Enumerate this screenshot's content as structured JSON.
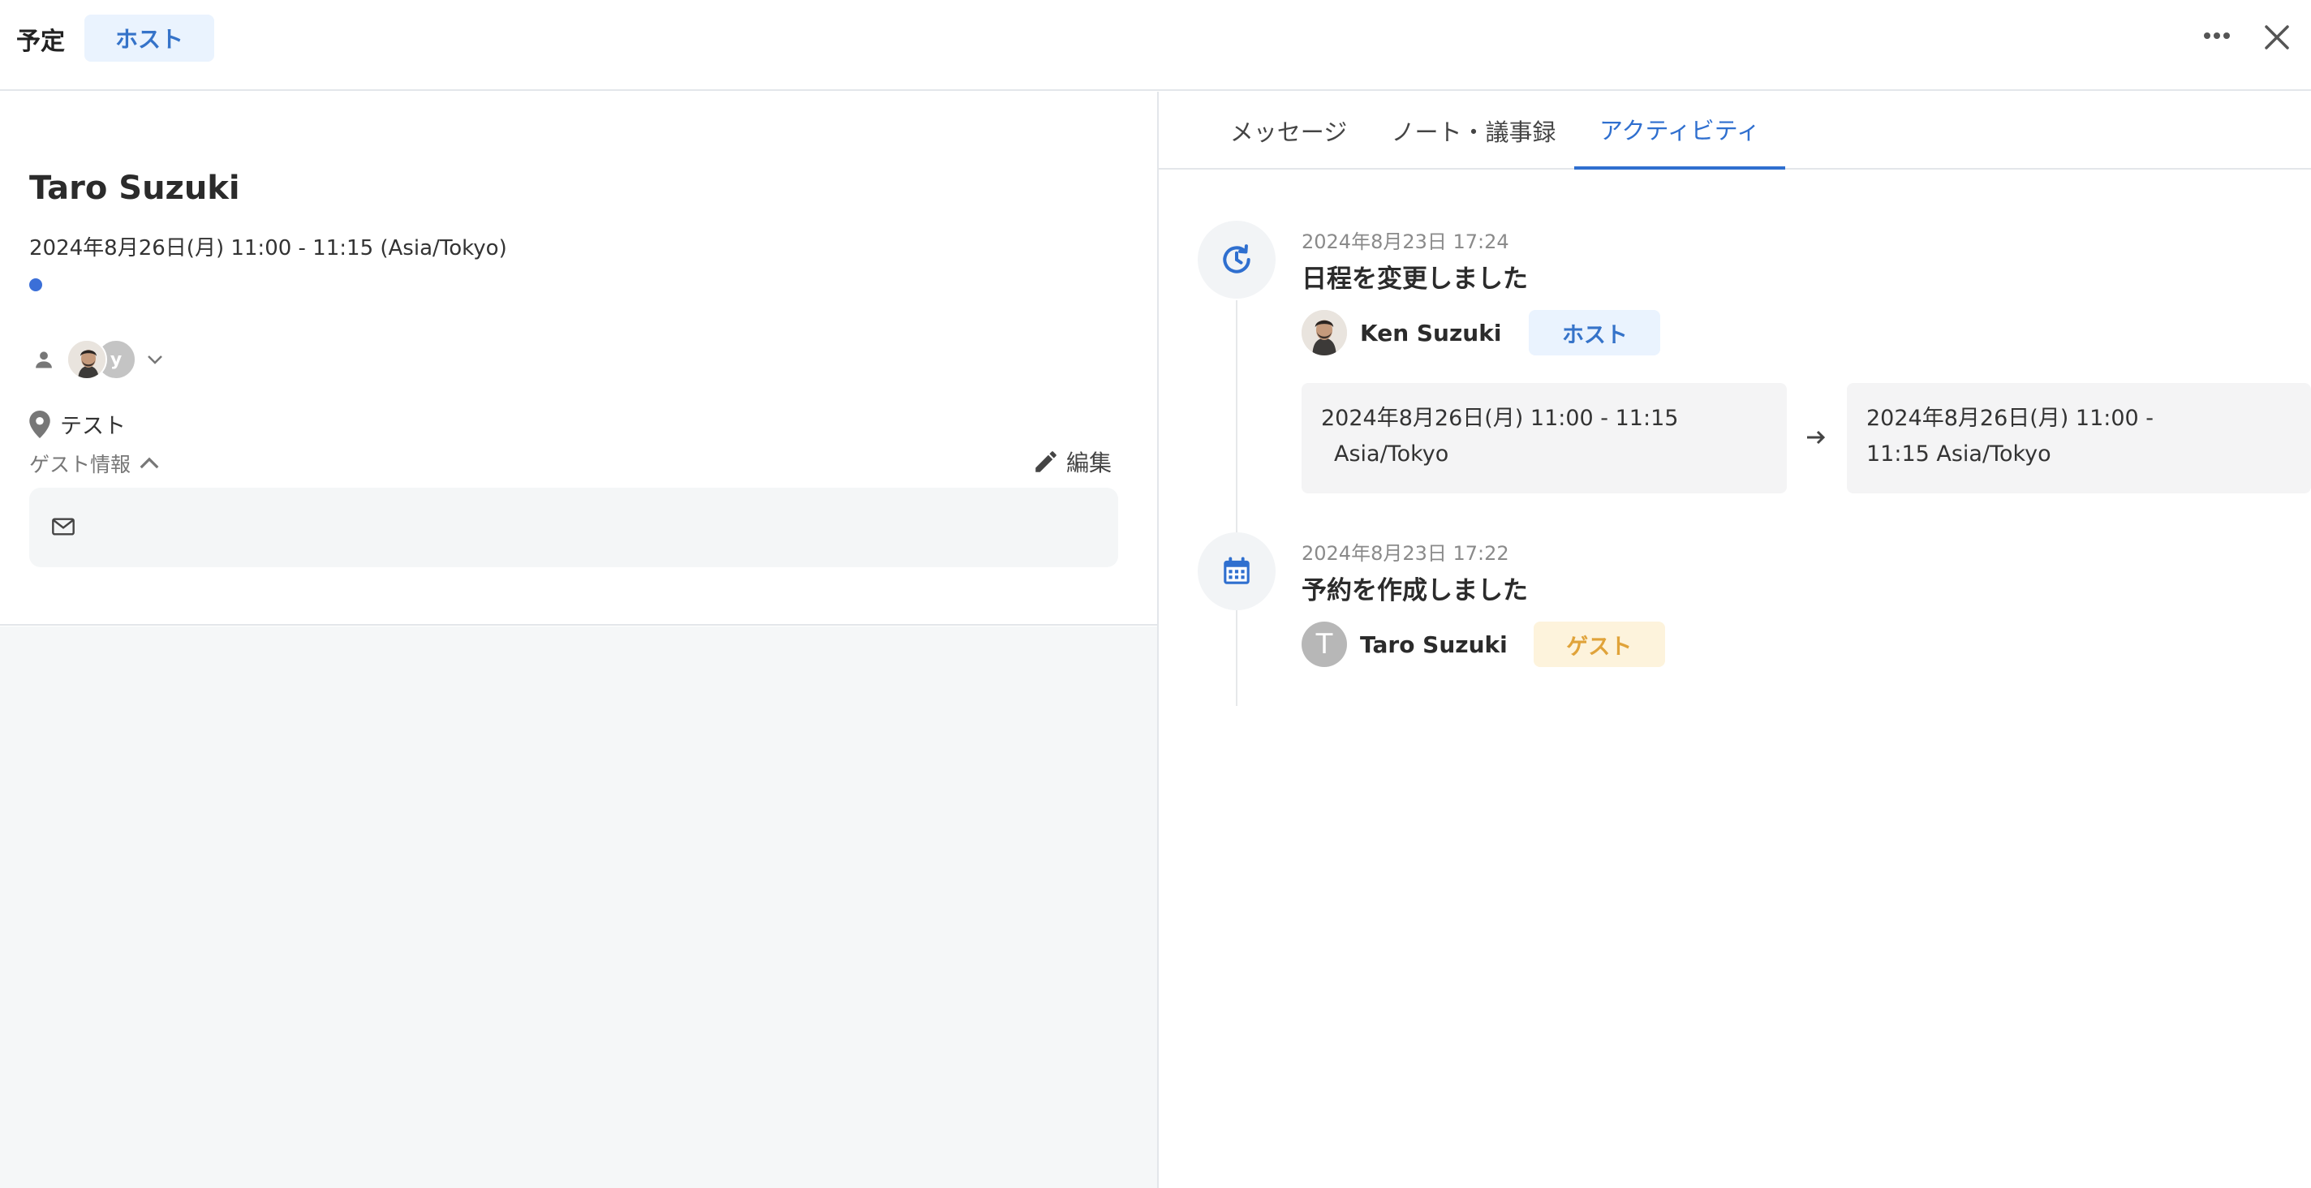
{
  "header": {
    "title": "予定",
    "role_badge": "ホスト"
  },
  "event": {
    "title": "Taro Suzuki",
    "datetime": "2024年8月26日(月) 11:00 - 11:15 (Asia/Tokyo)",
    "attendee_initial": "y",
    "location": "テスト",
    "guest_info_label": "ゲスト情報",
    "edit_label": "編集"
  },
  "tabs": [
    {
      "label": "メッセージ",
      "active": false
    },
    {
      "label": "ノート・議事録",
      "active": false
    },
    {
      "label": "アクティビティ",
      "active": true
    }
  ],
  "activity": [
    {
      "time": "2024年8月23日 17:24",
      "heading": "日程を変更しました",
      "user_name": "Ken Suzuki",
      "user_role": "ホスト",
      "from_line1": "2024年8月26日(月) 11:00 - 11:15",
      "from_line2": "Asia/Tokyo",
      "to_line1": "2024年8月26日(月) 11:00 -",
      "to_line2": "11:15  Asia/Tokyo"
    },
    {
      "time": "2024年8月23日 17:22",
      "heading": "予約を作成しました",
      "user_initial": "T",
      "user_name": "Taro Suzuki",
      "user_role": "ゲスト"
    }
  ],
  "colors": {
    "accent": "#2f6fcf",
    "host_badge_bg": "#eaf3fe",
    "guest_badge_bg": "#fdf3dc",
    "guest_badge_text": "#e0a33a"
  }
}
